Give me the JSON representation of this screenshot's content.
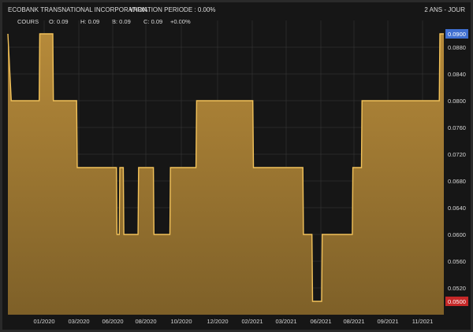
{
  "header": {
    "instrument": "ECOBANK TRANSNATIONAL INCORPORATION",
    "variation": "VARIATION PERIODE : 0.00%",
    "period": "2 ANS - JOUR"
  },
  "quote": {
    "label": "COURS",
    "open": "O: 0.09",
    "high": "H: 0.09",
    "low": "B: 0.09",
    "close": "C: 0.09",
    "change": "+0.00%"
  },
  "colors": {
    "background": "#161616",
    "area_fill_top": "#b68a3a",
    "area_fill_bottom": "#7e6028",
    "line": "#f2c25a",
    "last_value_badge": "#3f6fd1",
    "min_value_badge": "#c62828",
    "grid": "#3a3a3a"
  },
  "chart_data": {
    "type": "area",
    "title": "",
    "xlabel": "",
    "ylabel": "",
    "x_tick_labels": [
      "01/2020",
      "03/2020",
      "06/2020",
      "08/2020",
      "10/2020",
      "12/2020",
      "02/2021",
      "03/2021",
      "06/2021",
      "08/2021",
      "09/2021",
      "11/2021"
    ],
    "y_tick_labels": [
      "0.0880",
      "0.0840",
      "0.0800",
      "0.0760",
      "0.0720",
      "0.0680",
      "0.0640",
      "0.0600",
      "0.0560",
      "0.0520"
    ],
    "ylim": [
      0.048,
      0.092
    ],
    "badges": {
      "last": "0.0900",
      "min": "0.0500"
    },
    "grid": true,
    "series": [
      {
        "points": [
          [
            "2019-11-01",
            0.09
          ],
          [
            "2019-11-07",
            0.08
          ],
          [
            "2019-12-26",
            0.08
          ],
          [
            "2019-12-27",
            0.09
          ],
          [
            "2020-01-19",
            0.09
          ],
          [
            "2020-01-20",
            0.08
          ],
          [
            "2020-03-01",
            0.08
          ],
          [
            "2020-03-02",
            0.07
          ],
          [
            "2020-05-10",
            0.07
          ],
          [
            "2020-05-11",
            0.06
          ],
          [
            "2020-05-15",
            0.06
          ],
          [
            "2020-05-16",
            0.07
          ],
          [
            "2020-05-22",
            0.07
          ],
          [
            "2020-05-23",
            0.06
          ],
          [
            "2020-06-17",
            0.06
          ],
          [
            "2020-06-18",
            0.07
          ],
          [
            "2020-07-14",
            0.07
          ],
          [
            "2020-07-15",
            0.06
          ],
          [
            "2020-08-12",
            0.06
          ],
          [
            "2020-08-13",
            0.07
          ],
          [
            "2020-09-27",
            0.07
          ],
          [
            "2020-09-28",
            0.08
          ],
          [
            "2021-01-05",
            0.08
          ],
          [
            "2021-01-06",
            0.07
          ],
          [
            "2021-04-03",
            0.07
          ],
          [
            "2021-04-04",
            0.06
          ],
          [
            "2021-04-19",
            0.06
          ],
          [
            "2021-04-20",
            0.05
          ],
          [
            "2021-05-06",
            0.05
          ],
          [
            "2021-05-07",
            0.06
          ],
          [
            "2021-06-29",
            0.06
          ],
          [
            "2021-06-30",
            0.07
          ],
          [
            "2021-07-15",
            0.07
          ],
          [
            "2021-07-16",
            0.08
          ],
          [
            "2021-11-29",
            0.08
          ],
          [
            "2021-11-30",
            0.09
          ],
          [
            "2021-12-07",
            0.09
          ]
        ]
      }
    ]
  }
}
